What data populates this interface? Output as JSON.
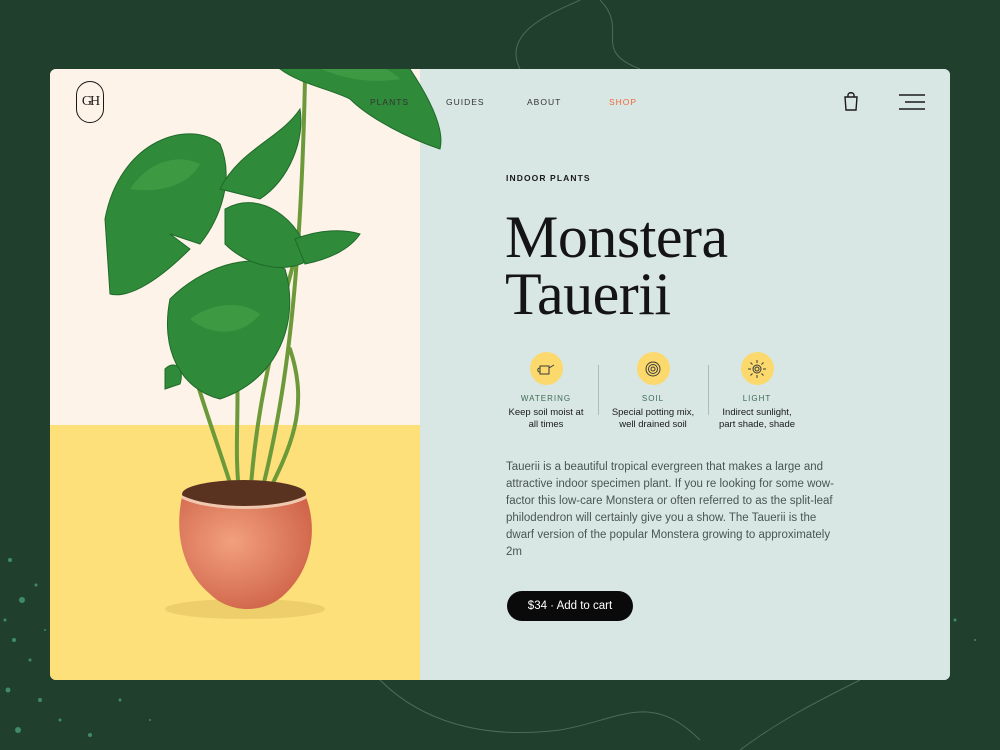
{
  "brand": {
    "logo_text": "GH"
  },
  "nav": {
    "items": [
      {
        "label": "PLANTS"
      },
      {
        "label": "GUIDES"
      },
      {
        "label": "ABOUT"
      },
      {
        "label": "SHOP"
      }
    ]
  },
  "colors": {
    "page_bg": "#213f2d",
    "cream": "#fdf3e8",
    "yellow": "#fde07a",
    "mint": "#d9e7e4",
    "accent": "#f0683c",
    "badge": "#fbd96d",
    "pot": "#e07a58"
  },
  "product": {
    "category": "INDOOR PLANTS",
    "title_line1": "Monstera",
    "title_line2": "Tauerii",
    "features": [
      {
        "icon": "watering-can-icon",
        "label": "WATERING",
        "desc_line1": "Keep soil moist at",
        "desc_line2": "all times"
      },
      {
        "icon": "soil-icon",
        "label": "SOIL",
        "desc_line1": "Special potting mix,",
        "desc_line2": "well drained soil"
      },
      {
        "icon": "sun-icon",
        "label": "LIGHT",
        "desc_line1": "Indirect sunlight,",
        "desc_line2": "part shade, shade"
      }
    ],
    "description": "Tauerii is a beautiful tropical evergreen that makes a large and attractive indoor specimen plant. If you re looking for some wow-factor this low-care Monstera or often referred to as the split-leaf philodendron will certainly give you a show. The Tauerii is the dwarf version of the popular Monstera growing to approximately 2m",
    "cart_label": "$34 · Add to cart"
  }
}
